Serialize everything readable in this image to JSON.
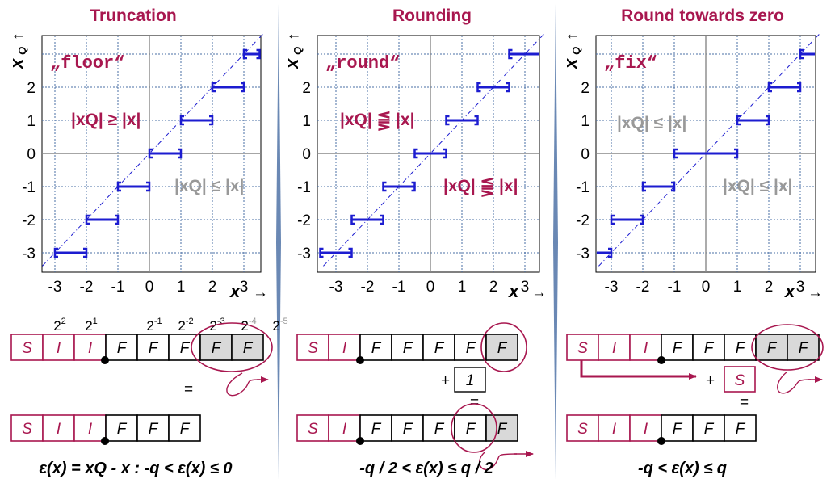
{
  "panels": [
    {
      "title": "Truncation",
      "function": "„floor“",
      "rel1": "|xQ| ≥ |x|",
      "rel2": "|xQ| ≤ |x|",
      "formula": "ε(x) = xQ - x :   -q < ε(x) ≤ 0"
    },
    {
      "title": "Rounding",
      "function": "„round“",
      "rel1": "|xQ| ⪋ |x|",
      "rel2": "|xQ| ⪋ |x|",
      "formula": "-q / 2 < ε(x) ≤ q / 2"
    },
    {
      "title": "Round towards zero",
      "function": "„fix“",
      "rel1": "|xQ| ≤ |x|",
      "rel2": "|xQ| ≤ |x|",
      "formula": "-q < ε(x) ≤ q"
    }
  ],
  "axes": {
    "x_label": "x",
    "x_arrow": "→",
    "y_label": "x",
    "y_sub": "Q",
    "y_arrow": "↑",
    "x_ticks": [
      "-3",
      "-2",
      "-1",
      "0",
      "1",
      "2",
      "3"
    ],
    "y_ticks": [
      "2",
      "1",
      "0",
      "-1",
      "-2",
      "-3"
    ]
  },
  "bits": {
    "S": "S",
    "I": "I",
    "F": "F",
    "powers": [
      {
        "base": "2",
        "exp": "2"
      },
      {
        "base": "2",
        "exp": "1"
      },
      {
        "base": "2",
        "exp": "-1"
      },
      {
        "base": "2",
        "exp": "-2"
      },
      {
        "base": "2",
        "exp": "-3"
      },
      {
        "base": "2",
        "exp": "-4"
      },
      {
        "base": "2",
        "exp": "-5"
      }
    ],
    "equals": "=",
    "plus": "+",
    "one": "1"
  },
  "colors": {
    "accent": "#a8174f",
    "line": "#1c1cd0",
    "grid": "#4a6fa5",
    "gray": "#999999",
    "shade": "#d9d9d9"
  }
}
